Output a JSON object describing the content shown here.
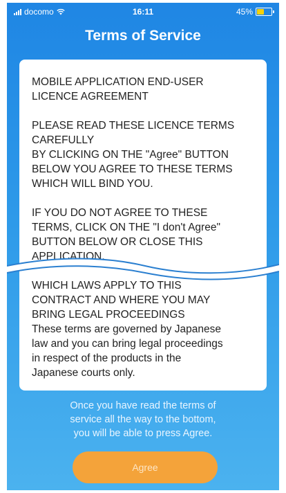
{
  "status_bar": {
    "carrier": "docomo",
    "time": "16:11",
    "battery_percent": "45%",
    "battery_level": 0.45,
    "battery_color": "#f5d10a"
  },
  "title": "Terms of Service",
  "terms": {
    "heading_line1": "MOBILE APPLICATION END-USER",
    "heading_line2": "LICENCE AGREEMENT",
    "read_line1": "PLEASE READ THESE LICENCE TERMS",
    "read_line2": "CAREFULLY",
    "read_line3": "BY CLICKING ON THE \"Agree\" BUTTON",
    "read_line4": "BELOW YOU AGREE TO THESE TERMS",
    "read_line5": "WHICH WILL BIND YOU.",
    "disagree_line1": "IF YOU DO NOT AGREE TO THESE",
    "disagree_line2": "TERMS, CLICK ON THE \"I don't Agree\"",
    "disagree_line3": "BUTTON BELOW OR CLOSE THIS",
    "disagree_line4": "APPLICATION.",
    "laws_line1": "WHICH LAWS APPLY TO THIS",
    "laws_line2": "CONTRACT AND WHERE YOU MAY",
    "laws_line3": "BRING LEGAL PROCEEDINGS",
    "governed_line1": "These terms are governed by Japanese",
    "governed_line2": "law and you can bring legal proceedings",
    "governed_line3": "in respect of the products in the",
    "governed_line4": "Japanese courts only."
  },
  "notice": {
    "line1": "Once you have read the terms of",
    "line2": "service all the way to the bottom,",
    "line3": "you will be able to press Agree."
  },
  "agree_button": "Agree",
  "colors": {
    "background_top": "#1f86e4",
    "background_bottom": "#4bb2ef",
    "button": "#f4a33a"
  }
}
